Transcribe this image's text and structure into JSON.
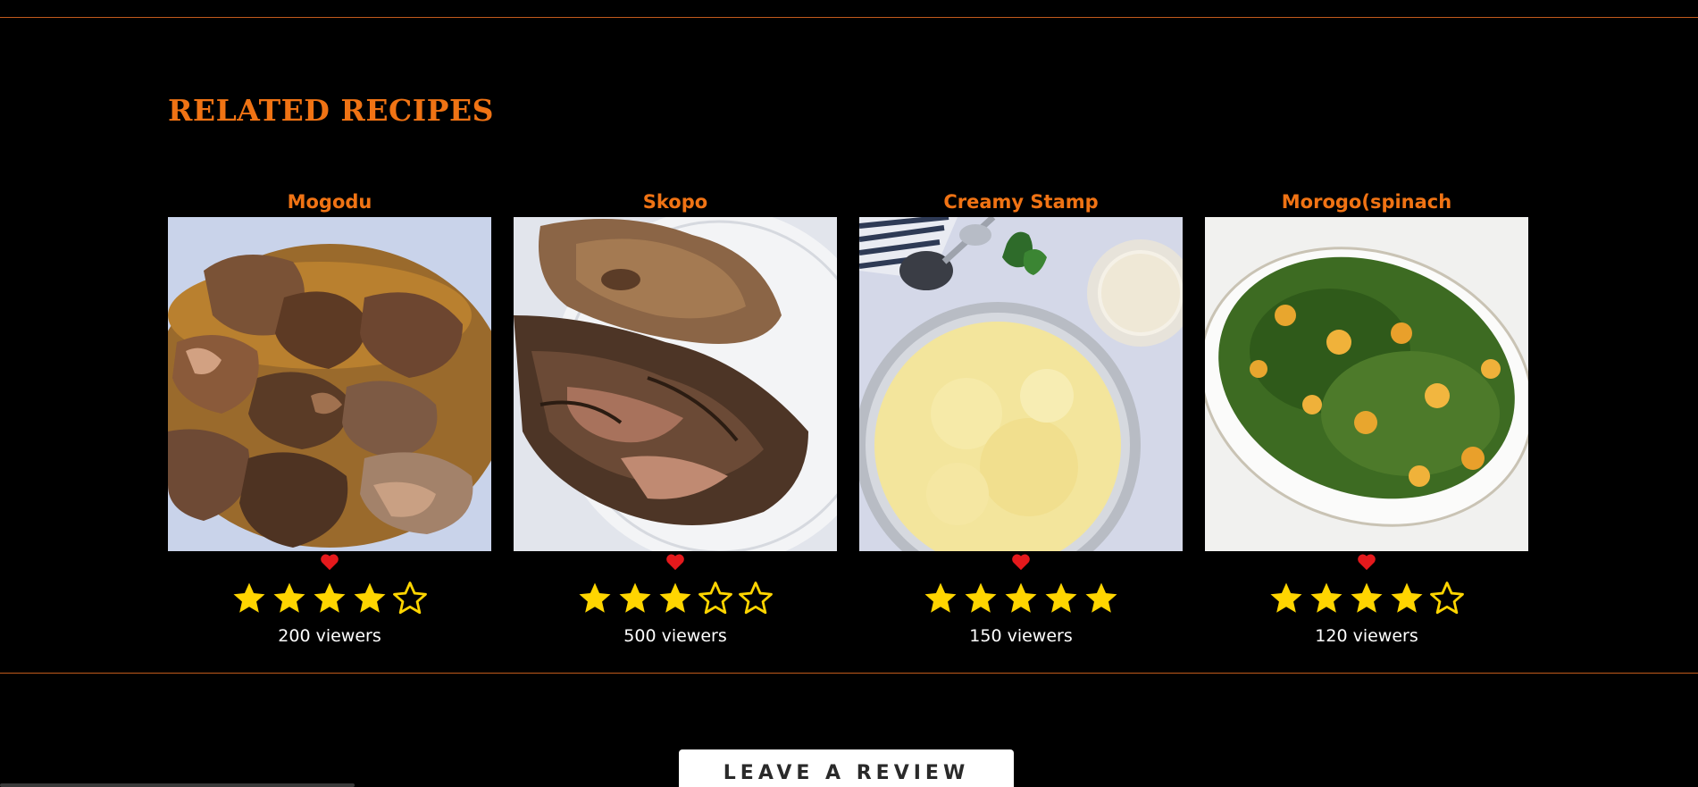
{
  "section": {
    "title": "RELATED RECIPES"
  },
  "recipes": [
    {
      "title": "Mogodu",
      "rating": 4,
      "max_rating": 5,
      "viewers": "200 viewers",
      "image_subject": "beef tripe stew"
    },
    {
      "title": "Skopo",
      "rating": 3,
      "max_rating": 5,
      "viewers": "500 viewers",
      "image_subject": "roasted sheep head on a plate"
    },
    {
      "title": "Creamy Stamp",
      "rating": 5,
      "max_rating": 5,
      "viewers": "150 viewers",
      "image_subject": "creamy samp in a bowl with parmesan and parsley"
    },
    {
      "title": "Morogo(spinach",
      "rating": 4,
      "max_rating": 5,
      "viewers": "120 viewers",
      "image_subject": "spinach and prawn dish on an oval platter"
    }
  ],
  "review_button": {
    "label": "LEAVE A REVIEW"
  },
  "colors": {
    "background": "#000000",
    "accent_orange": "#f07314",
    "divider": "#c05a1c",
    "star_fill": "#ffd500",
    "heart": "#e5191c",
    "text": "#ffffff"
  },
  "icons": {
    "favorite": "heart-icon",
    "rating_full": "star-filled-icon",
    "rating_empty": "star-outline-icon"
  }
}
